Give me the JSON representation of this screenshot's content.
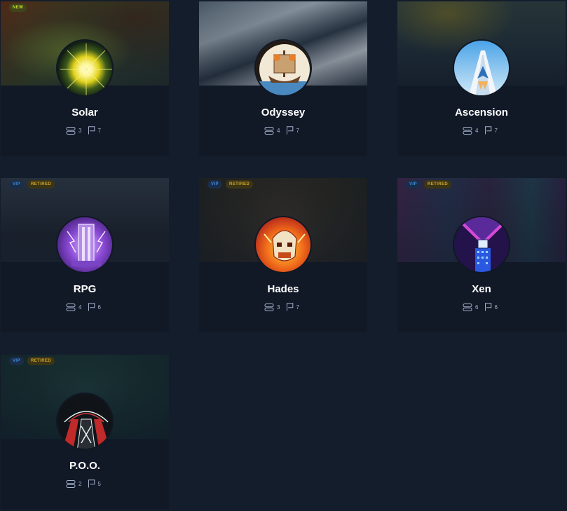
{
  "colors": {
    "page_background": "#141d2b",
    "card_background": "#111927",
    "new_badge": "#c2e02a",
    "vip_badge": "#3d8fe0",
    "retired_badge": "#d0a52c"
  },
  "cards": [
    {
      "name": "Solar",
      "badges": [
        "NEW"
      ],
      "servers": "3",
      "flags": "7",
      "avatar_icon": "solar-avatar-icon"
    },
    {
      "name": "Odyssey",
      "badges": [],
      "servers": "4",
      "flags": "7",
      "avatar_icon": "odyssey-avatar-icon"
    },
    {
      "name": "Ascension",
      "badges": [],
      "servers": "4",
      "flags": "7",
      "avatar_icon": "ascension-avatar-icon"
    },
    {
      "name": "RPG",
      "badges": [
        "VIP",
        "RETIRED"
      ],
      "servers": "4",
      "flags": "6",
      "avatar_icon": "rpg-avatar-icon"
    },
    {
      "name": "Hades",
      "badges": [
        "VIP",
        "RETIRED"
      ],
      "servers": "3",
      "flags": "7",
      "avatar_icon": "hades-avatar-icon"
    },
    {
      "name": "Xen",
      "badges": [
        "VIP",
        "RETIRED"
      ],
      "servers": "6",
      "flags": "6",
      "avatar_icon": "xen-avatar-icon"
    },
    {
      "name": "P.O.O.",
      "badges": [
        "VIP",
        "RETIRED"
      ],
      "servers": "2",
      "flags": "5",
      "avatar_icon": "poo-avatar-icon"
    }
  ]
}
